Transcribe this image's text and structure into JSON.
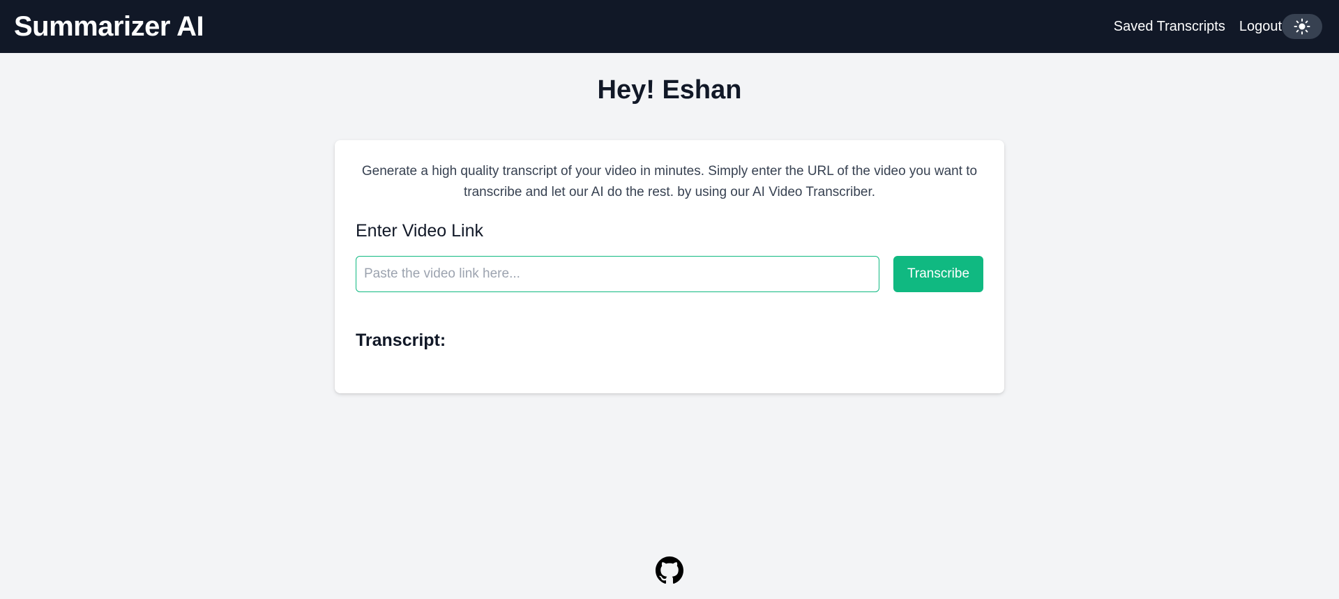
{
  "navbar": {
    "brand": "Summarizer AI",
    "links": {
      "saved": "Saved Transcripts",
      "logout": "Logout"
    },
    "theme_icon": "sun-icon"
  },
  "greeting": "Hey! Eshan",
  "card": {
    "intro": "Generate a high quality transcript of your video in minutes. Simply enter the URL of the video you want to transcribe and let our AI do the rest. by using our AI Video Transcriber.",
    "section_label": "Enter Video Link",
    "input": {
      "placeholder": "Paste the video link here...",
      "value": ""
    },
    "button_label": "Transcribe",
    "transcript_label": "Transcript:"
  },
  "footer": {
    "icon": "github-icon"
  },
  "colors": {
    "navbar_bg": "#111827",
    "page_bg": "#f3f4f6",
    "accent": "#10b981"
  }
}
